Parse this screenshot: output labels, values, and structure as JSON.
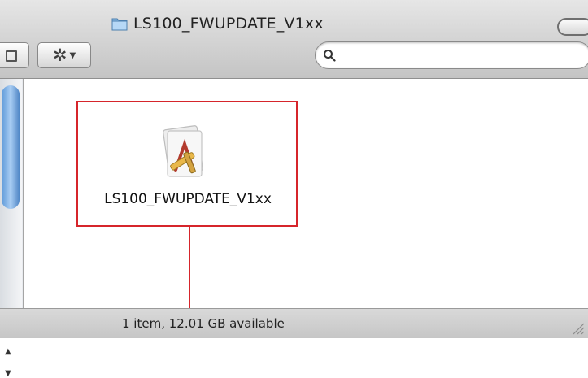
{
  "window": {
    "title": "LS100_FWUPDATE_V1xx"
  },
  "toolbar": {
    "action_icon": "gear-icon",
    "search_placeholder": ""
  },
  "content": {
    "items": [
      {
        "name": "LS100_FWUPDATE_V1xx",
        "icon": "application-icon"
      }
    ]
  },
  "status": {
    "text": "1 item, 12.01 GB available"
  },
  "annotation": {
    "highlight_color": "#d6252b"
  }
}
